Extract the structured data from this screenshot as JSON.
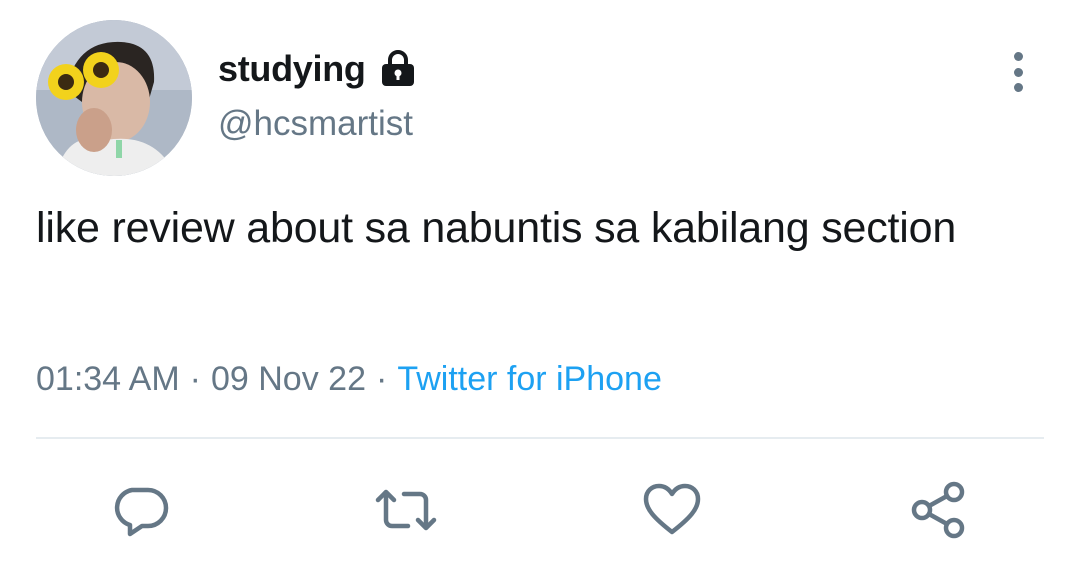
{
  "user": {
    "display_name": "studying",
    "handle": "@hcsmartist",
    "protected_icon": "lock-icon"
  },
  "tweet": {
    "text": "like review about sa nabuntis sa kabilang section",
    "time": "01:34 AM",
    "separator": "·",
    "date": "09 Nov 22",
    "source": "Twitter for iPhone"
  },
  "actions": [
    {
      "name": "reply",
      "icon": "reply-icon"
    },
    {
      "name": "retweet",
      "icon": "retweet-icon"
    },
    {
      "name": "like",
      "icon": "heart-icon"
    },
    {
      "name": "share",
      "icon": "share-icon"
    }
  ],
  "colors": {
    "text": "#14171a",
    "secondary": "#657786",
    "link": "#1da1f2",
    "divider": "#e6ecf0"
  }
}
